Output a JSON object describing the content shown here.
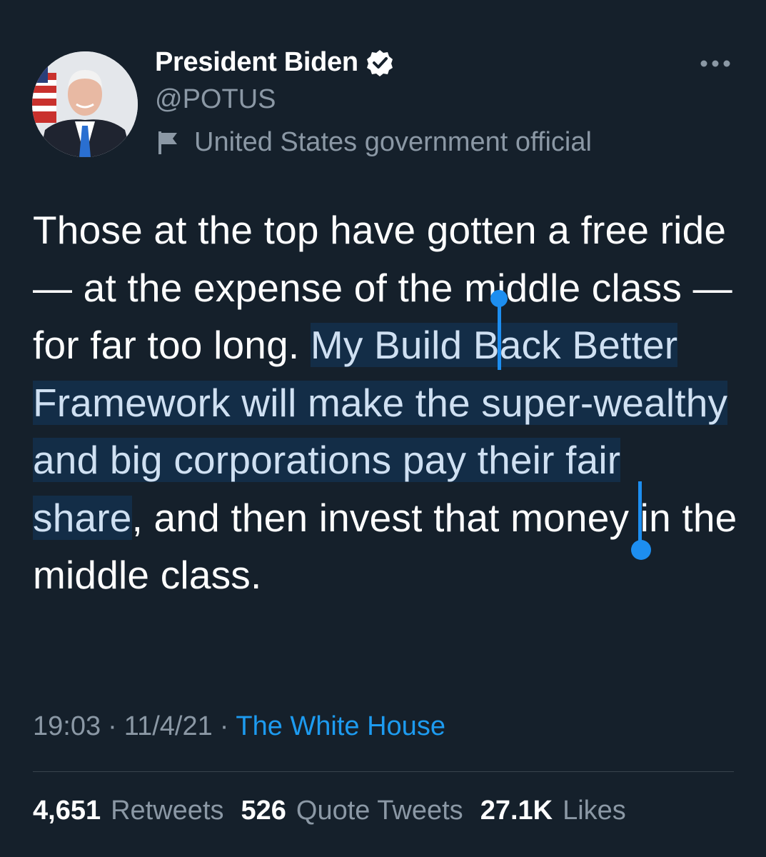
{
  "author": {
    "display_name": "President Biden",
    "handle": "@POTUS",
    "label": "United States government official",
    "verified_icon": "verified-badge-icon",
    "label_icon": "flag-icon",
    "avatar": "avatar-photo"
  },
  "tweet": {
    "text_before": "Those at the top have gotten a free ride — at the expense of the middle class — for far too long. ",
    "text_selected": "My Build Back Better Framework will make the super-wealthy and big corporations pay their fair share",
    "text_after": ", and then invest that money in the middle class."
  },
  "meta": {
    "time": "19:03",
    "separator": "·",
    "date": "11/4/21",
    "source": "The White House"
  },
  "stats": {
    "retweets_count": "4,651",
    "retweets_label": "Retweets",
    "quotes_count": "526",
    "quotes_label": "Quote Tweets",
    "likes_count": "27.1K",
    "likes_label": "Likes"
  },
  "colors": {
    "background": "#15202b",
    "accent": "#1d9bf0",
    "secondary_text": "#8b98a5",
    "selection": "#132d47"
  }
}
